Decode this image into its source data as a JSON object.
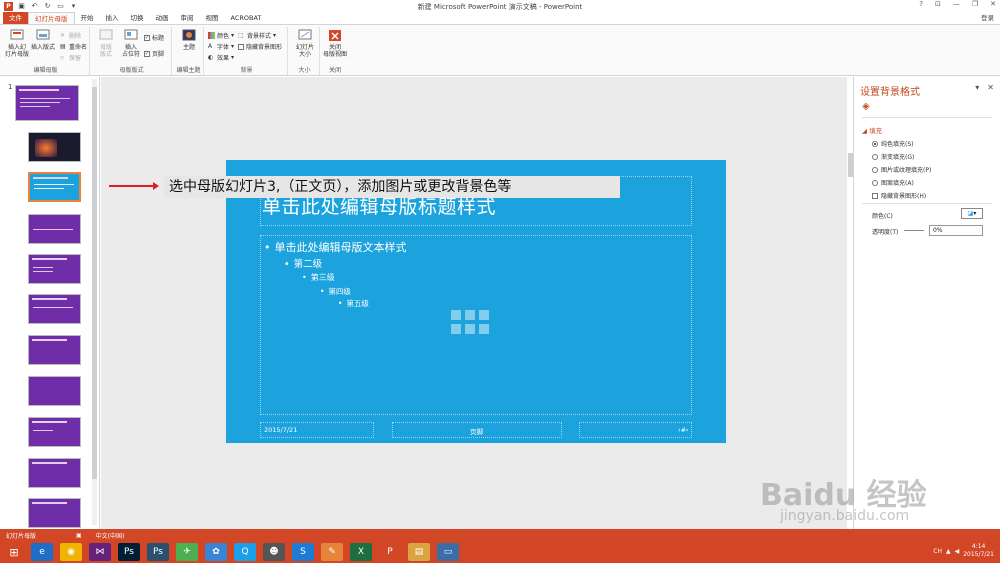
{
  "window": {
    "title": "新建 Microsoft PowerPoint 演示文稿 - PowerPoint",
    "controls": [
      "?",
      "⊡",
      "—",
      "❐",
      "✕"
    ],
    "signin": "登录"
  },
  "ribbon_tabs": [
    {
      "label": "文件",
      "kind": "file"
    },
    {
      "label": "幻灯片母版",
      "kind": "active"
    },
    {
      "label": "开始",
      "kind": ""
    },
    {
      "label": "插入",
      "kind": ""
    },
    {
      "label": "切换",
      "kind": ""
    },
    {
      "label": "动画",
      "kind": ""
    },
    {
      "label": "审阅",
      "kind": ""
    },
    {
      "label": "视图",
      "kind": ""
    },
    {
      "label": "ACROBAT",
      "kind": ""
    }
  ],
  "ribbon": {
    "group_edit_master": "编辑母版",
    "insert_master": "插入幻灯片母版",
    "insert_master_l1": "插入幻",
    "insert_master_l2": "灯片母版",
    "insert_layout": "插入版式",
    "delete": "删除",
    "rename": "重命名",
    "preserve": "保留",
    "group_master_layout": "母版版式",
    "master_layout_l1": "母版",
    "master_layout_l2": "版式",
    "insert_placeholder_l1": "插入",
    "insert_placeholder_l2": "占位符",
    "title_chk": "标题",
    "footer_chk": "页脚",
    "group_theme": "编辑主题",
    "themes": "主题",
    "colors": "颜色",
    "fonts": "字体",
    "effects": "效果",
    "group_background": "背景",
    "bg_styles": "背景样式",
    "hide_bg": "隐藏背景图形",
    "group_size": "大小",
    "slide_size_l1": "幻灯片",
    "slide_size_l2": "大小",
    "group_close": "关闭",
    "close_l1": "关闭",
    "close_l2": "母版视图"
  },
  "thumbnails": {
    "first_number": "1"
  },
  "slide": {
    "title": "单击此处编辑母版标题样式",
    "levels": [
      "单击此处编辑母版文本样式",
      "第二级",
      "第三级",
      "第四级",
      "第五级"
    ],
    "footer_date": "2015/7/21",
    "footer_center": "页脚",
    "footer_num": "‹#›",
    "bg_color": "#1ca3dd"
  },
  "annotation": {
    "text": "选中母版幻灯片3,（正文页），添加图片或更改背景色等"
  },
  "taskpane": {
    "title": "设置背景格式",
    "section_fill": "填充",
    "options": [
      {
        "label": "纯色填充(S)",
        "selected": true
      },
      {
        "label": "渐变填充(G)",
        "selected": false
      },
      {
        "label": "图片或纹理填充(P)",
        "selected": false
      },
      {
        "label": "图案填充(A)",
        "selected": false
      }
    ],
    "hide_bg_graphics": "隐藏背景图形(H)",
    "color_label": "颜色(C)",
    "transparency_label": "透明度(T)",
    "transparency_value": "0%"
  },
  "statusbar": {
    "view": "幻灯片母版",
    "language": "中文(中国)"
  },
  "taskbar": {
    "apps": [
      "IE",
      "Chrome",
      "VS",
      "Ps",
      "Ps2",
      "Bird",
      "App",
      "QQ",
      "Panda",
      "Sogou",
      "Fox",
      "Excel",
      "PowerPoint",
      "Folder",
      "Window"
    ],
    "clock_time": "4:14",
    "clock_date": "2015/7/21",
    "ime": "CH"
  },
  "watermark": {
    "text": "Baidu 经验",
    "sub": "jingyan.baidu.com"
  },
  "colors": {
    "accent": "#d24726",
    "slide_bg": "#1ca3dd",
    "master_thumb": "#6f2da8",
    "arrow": "#e02020"
  }
}
